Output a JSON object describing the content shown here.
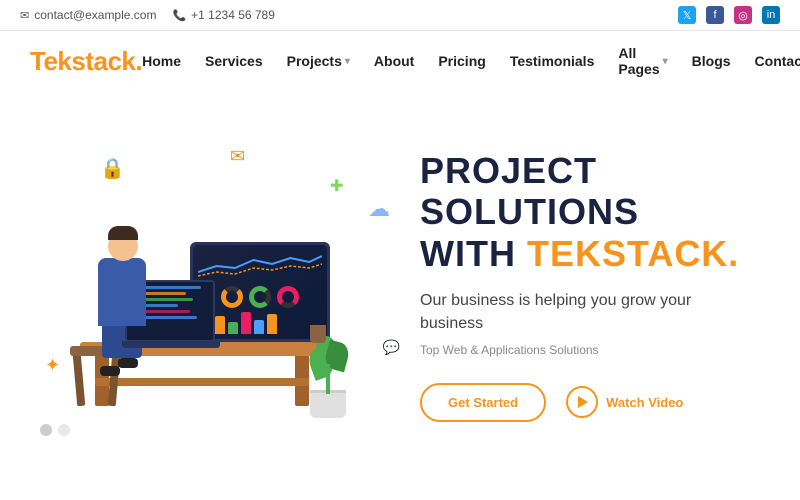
{
  "topbar": {
    "email": "contact@example.com",
    "phone": "+1 1234 56 789",
    "email_icon": "✉",
    "phone_icon": "📞"
  },
  "social": {
    "twitter": "T",
    "facebook": "f",
    "instagram": "in",
    "linkedin": "in"
  },
  "nav": {
    "logo_text": "Tekstack",
    "logo_dot": ".",
    "links": [
      {
        "label": "Home",
        "has_dropdown": false
      },
      {
        "label": "Services",
        "has_dropdown": false
      },
      {
        "label": "Projects",
        "has_dropdown": true
      },
      {
        "label": "About",
        "has_dropdown": false
      },
      {
        "label": "Pricing",
        "has_dropdown": false
      },
      {
        "label": "Testimonials",
        "has_dropdown": false
      },
      {
        "label": "All Pages",
        "has_dropdown": true
      },
      {
        "label": "Blogs",
        "has_dropdown": false
      },
      {
        "label": "Contact",
        "has_dropdown": false
      }
    ]
  },
  "hero": {
    "title_line1": "PROJECT SOLUTIONS",
    "title_line2_before": "WITH ",
    "title_line2_accent": "TEKSTACK.",
    "subtitle": "Our business is helping you grow your business",
    "tagline": "Top Web & Applications Solutions",
    "btn_get_started": "Get Started",
    "btn_watch": "Watch Video"
  },
  "decorations": {
    "lock_emoji": "🔒",
    "mail_emoji": "✉",
    "cloud_emoji": "☁",
    "star_emoji": "✦",
    "plus_emoji": "✚"
  },
  "dots": {
    "items": [
      "",
      "",
      ""
    ]
  }
}
